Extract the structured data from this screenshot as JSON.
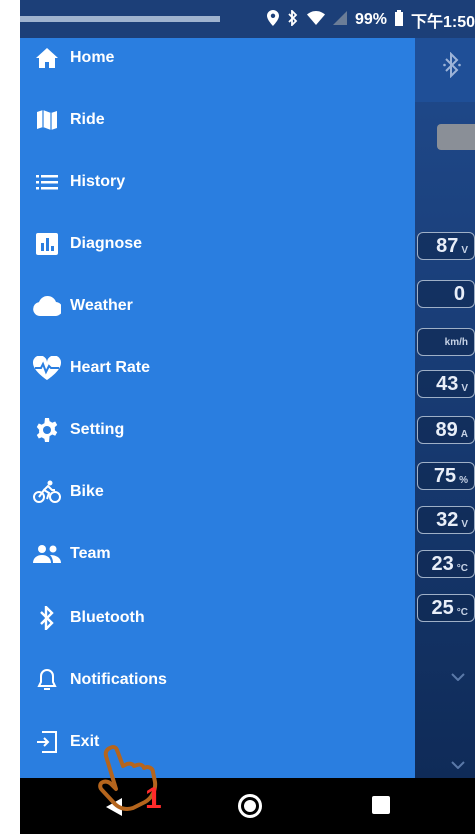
{
  "status_bar": {
    "battery": "99%",
    "time": "下午1:50",
    "icons": [
      "location-icon",
      "bluetooth-icon",
      "wifi-icon",
      "signal-icon",
      "battery-icon"
    ]
  },
  "drawer": {
    "items": [
      {
        "label": "Home",
        "icon": "home-icon"
      },
      {
        "label": "Ride",
        "icon": "map-icon"
      },
      {
        "label": "History",
        "icon": "list-icon"
      },
      {
        "label": "Diagnose",
        "icon": "chart-icon"
      },
      {
        "label": "Weather",
        "icon": "cloud-icon"
      },
      {
        "label": "Heart Rate",
        "icon": "heart-rate-icon"
      },
      {
        "label": "Setting",
        "icon": "gear-icon"
      },
      {
        "label": "Bike",
        "icon": "bike-icon"
      },
      {
        "label": "Team",
        "icon": "team-icon"
      },
      {
        "label": "Bluetooth",
        "icon": "bluetooth-icon"
      },
      {
        "label": "Notifications",
        "icon": "bell-icon"
      },
      {
        "label": "Exit",
        "icon": "exit-icon"
      }
    ]
  },
  "background": {
    "readings": [
      {
        "value": "87",
        "unit": "V"
      },
      {
        "value": "0",
        "unit": ""
      },
      {
        "value": "",
        "unit": "km/h"
      },
      {
        "value": "43",
        "unit": "V"
      },
      {
        "value": "89",
        "unit": "A"
      },
      {
        "value": "75",
        "unit": "%"
      },
      {
        "value": "32",
        "unit": "V"
      },
      {
        "value": "23",
        "unit": "°C"
      },
      {
        "value": "25",
        "unit": "°C"
      }
    ]
  },
  "annotation": {
    "number": "1",
    "icon": "pointing-hand-icon"
  },
  "colors": {
    "drawer": "#2a7ee0",
    "status_bar": "#1c3f78",
    "annotation": "#ff2a2a",
    "hand_outline": "#b5651d"
  }
}
